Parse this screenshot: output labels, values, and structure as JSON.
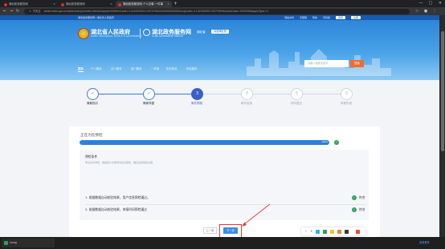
{
  "browser": {
    "tabs": [
      {
        "title": "湖北政务服务网"
      },
      {
        "title": "湖北政务服务网"
      },
      {
        "title": "湖北政务服务网-个人办事-一件事",
        "active": true
      }
    ],
    "new_tab": "+",
    "address_secure_label": "不安全",
    "address": "zwfw.hubei.gov.cn/webview/yjs/index.html#/applyInfo?itemCode=114200000113572Y0K4420000000000&orgCode=11420000011357Y0K4&areaCode=420000&applyType=1",
    "window_controls": [
      "—",
      "□",
      "✕"
    ]
  },
  "site": {
    "top_left": "湖北政务服务网 | 湖北省人民政府",
    "top_right": [
      "我的办件",
      "无障碍",
      "繁体",
      "手机版"
    ],
    "login": "登录",
    "register": "注册",
    "gov_name": "湖北省人民政府",
    "gov_sub": "HUBEI PROVINCIAL PEOPLE'S GOVERNMENT",
    "service_name": "湖北政务服务网",
    "service_sub": "HUBEI GOVERNMENT SERVICE",
    "region": "湖北省",
    "region_switch": "请选择区划",
    "search_placeholder": "请输入搜索关键字",
    "search_button": "搜索",
    "nav": [
      "首页",
      "个人服务",
      "法人服务",
      "部门服务",
      "一件事",
      "阳光政务",
      "特色服务"
    ]
  },
  "steps": [
    {
      "num": "✓",
      "label": "情景指引",
      "state": "done"
    },
    {
      "num": "✓",
      "label": "情景导图",
      "state": "done"
    },
    {
      "num": "3",
      "label": "条件预检",
      "state": "active"
    },
    {
      "num": "4",
      "label": "填写信息",
      "state": "todo"
    },
    {
      "num": "5",
      "label": "材料提交",
      "state": "todo"
    },
    {
      "num": "6",
      "label": "申报完成",
      "state": "todo"
    }
  ],
  "precheck": {
    "title": "正在为您预检",
    "progress": 1.0,
    "progress_label": "100%",
    "conditions_title": "预检条件",
    "conditions_desc": "申请条件审核，根据用户办事申请情况审核，确定是否能够办理",
    "conditions": [
      {
        "text": "1. 根据数据自动校验结果，用户信息预检通过。",
        "result": "符合"
      },
      {
        "text": "2. 根据数据自动校验结果，申报时间预检通过",
        "result": "符合"
      }
    ],
    "prev_button": "上一步",
    "next_button": "下一步"
  },
  "annotation_toolbar": {
    "colors": [
      "#2fb3e8",
      "#2aa15a",
      "#f2c12e",
      "#e5882f",
      "#3a3a3a",
      "#e84a3c"
    ]
  },
  "taskbar": {
    "app": "Lsing",
    "link": "查看更多"
  },
  "colors": {
    "accent": "#3a61c8",
    "header_blue": "#2d86d8",
    "success": "#2aa15a",
    "highlight": "#e53935"
  }
}
